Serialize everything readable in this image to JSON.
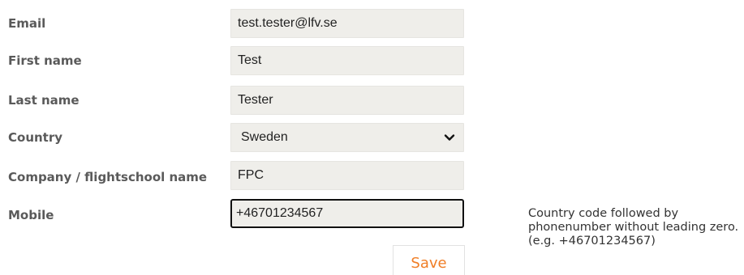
{
  "form": {
    "email": {
      "label": "Email",
      "value": "test.tester@lfv.se"
    },
    "first_name": {
      "label": "First name",
      "value": "Test"
    },
    "last_name": {
      "label": "Last name",
      "value": "Tester"
    },
    "country": {
      "label": "Country",
      "value": "Sweden"
    },
    "company": {
      "label": "Company / flightschool name",
      "value": "FPC"
    },
    "mobile": {
      "label": "Mobile",
      "value": "+46701234567"
    },
    "mobile_help": "Country code followed by phonenumber without leading zero. (e.g. +46701234567)",
    "save_label": "Save"
  },
  "colors": {
    "field_background": "#efeeea",
    "save_text": "#f07e26",
    "label_text": "#5a5a5a"
  },
  "icons": {
    "country_select": "chevron-down-icon"
  }
}
